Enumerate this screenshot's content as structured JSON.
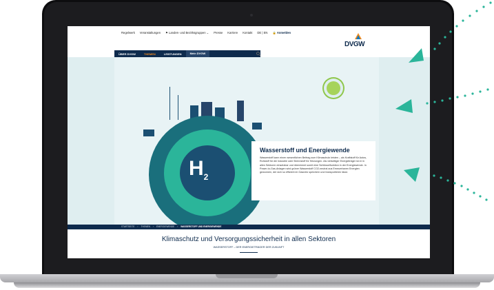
{
  "utility_nav": [
    "Regelwerk",
    "Veranstaltungen",
    "Landes- und Bezirksgruppen",
    "Presse",
    "Karriere",
    "Kontakt",
    "DE | EN",
    "Anmelden"
  ],
  "logo": {
    "text": "DVGW"
  },
  "main_nav": {
    "items": [
      "ÜBER DVGW",
      "THEMEN",
      "LEISTUNGEN",
      "Mein DVGW"
    ],
    "active": "THEMEN",
    "search_label": "SUCHEN"
  },
  "hero": {
    "badge": "H",
    "badge_sub": "2",
    "title": "Wasserstoff und Energiewende",
    "body": "Wasserstoff kann einen wesentlichen Beitrag zum Klimaschutz leisten – als Kraftstoff für Autos, Rohstoff für die Industrie oder Brennstoff für Heizungen. Als vielseitiger Energieträger ist er in allen Sektoren einsetzbar und übernimmt somit eine Schlüsselfunktion in der Energiewende. In Power-to-Gas-Anlagen wird grüner Wasserstoff CO2-neutral aus Erneuerbaren Energien gewonnen, der sich so effizient im Gasnetz speichern und transportieren lässt."
  },
  "breadcrumb": [
    "STARTSEITE",
    "THEMEN",
    "ENERGIEWENDE",
    "WASSERSTOFF UND ENERGIEWENDE"
  ],
  "section": {
    "title": "Klimaschutz und Versorgungssicherheit in allen Sektoren",
    "subtitle": "WASSERSTOFF – DER ENERGIETRÄGER DER ZUKUNFT"
  },
  "colors": {
    "navy": "#0e2b4d",
    "teal": "#2bb59a",
    "orange": "#f28a1e",
    "hero_bg": "#dfeef0",
    "arrows": "#2bb59a"
  }
}
